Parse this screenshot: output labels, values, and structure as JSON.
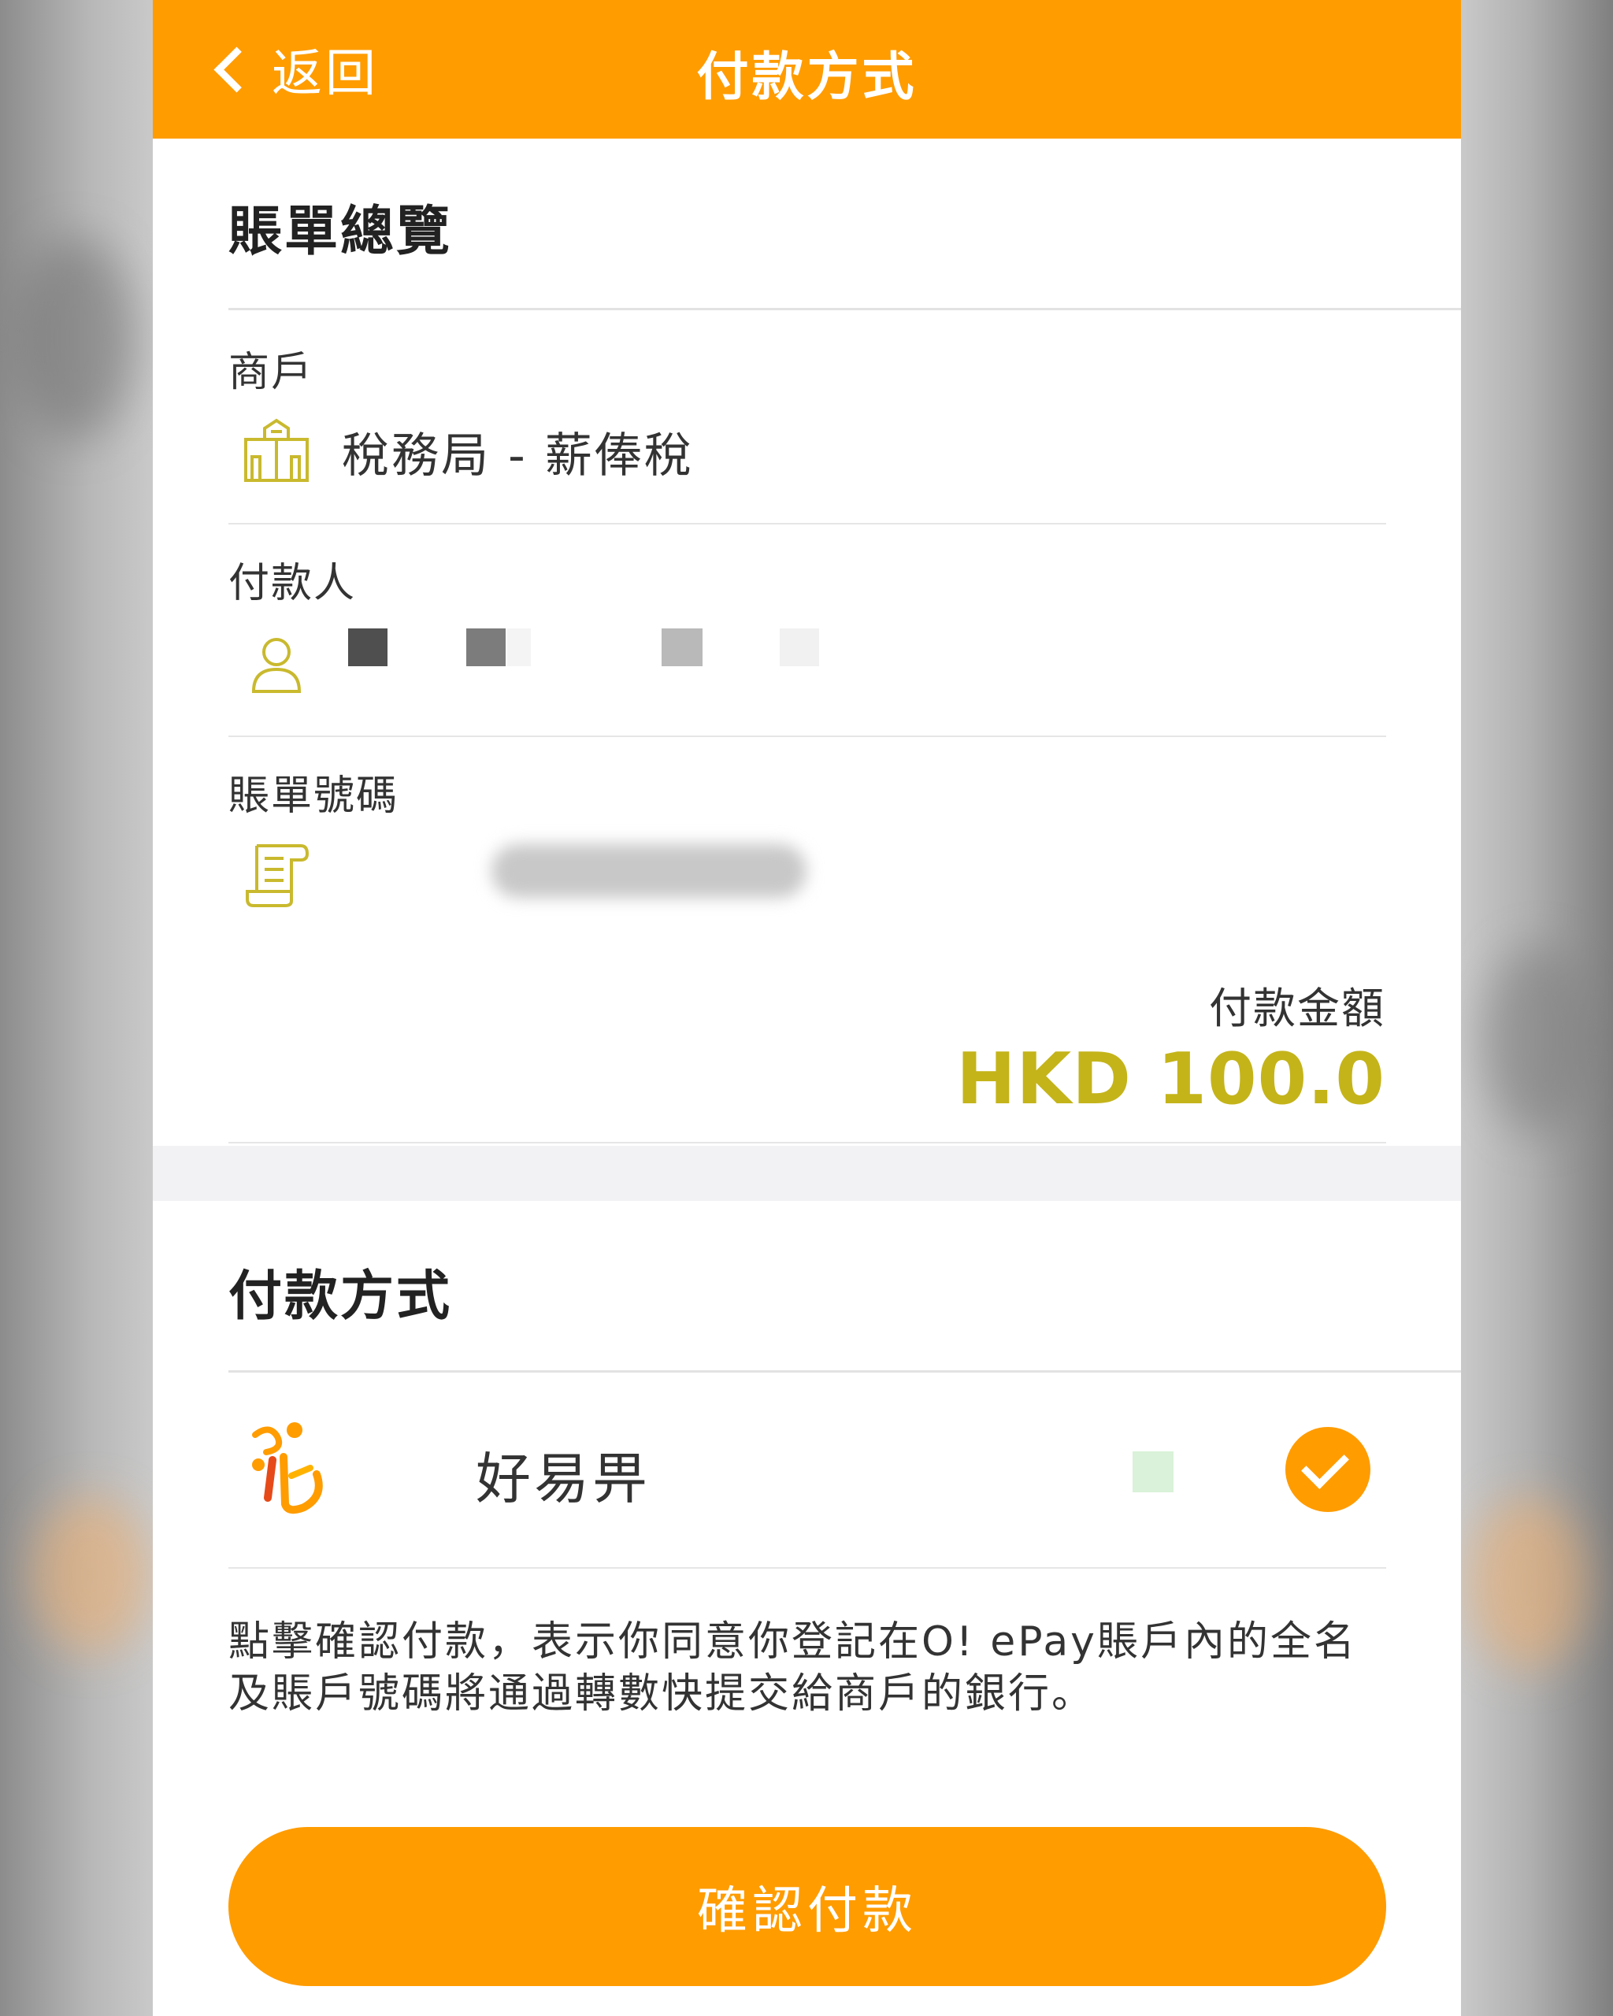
{
  "header": {
    "back_label": "返回",
    "title": "付款方式"
  },
  "bill_overview": {
    "section_title": "賬單總覽",
    "merchant_label": "商戶",
    "merchant_value": "稅務局 - 薪俸稅",
    "payer_label": "付款人",
    "bill_number_label": "賬單號碼",
    "amount_label": "付款金額",
    "amount_value": "HKD 100.0"
  },
  "payment_method": {
    "section_title": "付款方式",
    "option_name": "好易畀",
    "selected": true
  },
  "notice": "點擊確認付款，表示你同意你登記在O! ePay賬戶內的全名及賬戶號碼將通過轉數快提交給商戶的銀行。",
  "confirm_button": "確認付款",
  "colors": {
    "brand_orange": "#ff9c00",
    "amount_gold": "#c4b41a",
    "icon_olive": "#c9b92e"
  }
}
